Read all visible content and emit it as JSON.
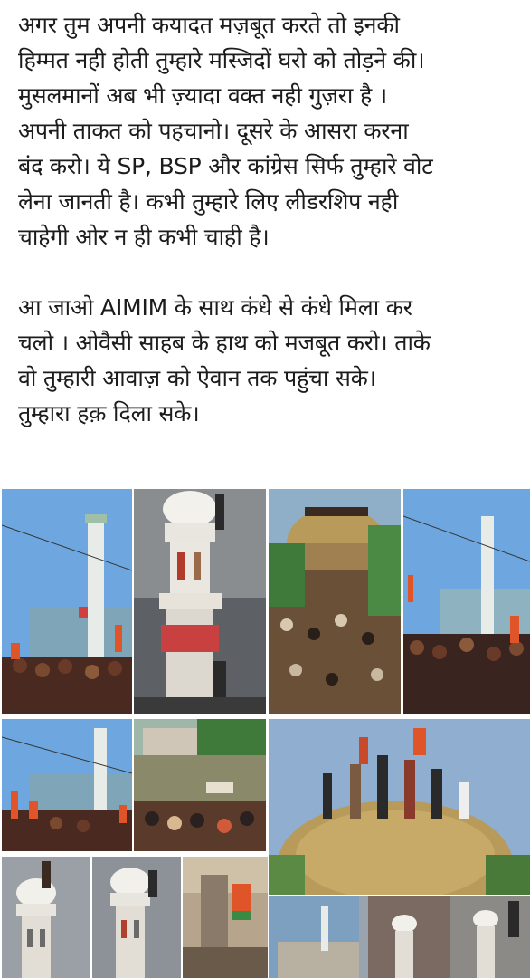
{
  "post": {
    "paragraph1_lines": [
      "अगर तुम अपनी कयादत मज़बूत करते तो इनकी",
      "हिम्मत नही होती तुम्हारे मस्जिदों घरो को तोड़ने की।",
      "मुसलमानों अब भी ज़्यादा वक्त नही गुज़रा है ।",
      "अपनी ताकत को पहचानो। दूसरे के आसरा करना",
      "बंद करो। ये SP, BSP और कांग्रेस सिर्फ तुम्हारे वोट",
      "लेना जानती है। कभी तुम्हारे लिए लीडरशिप नही",
      "चाहेगी ओर न ही कभी चाही है।"
    ],
    "paragraph2_lines": [
      "आ जाओ AIMIM के साथ कंधे से कंधे मिला कर",
      "चलो । ओवैसी साहब के हाथ को मजबूत करो। ताके",
      "वो तुम्हारी आवाज़ को ऐवान तक पहुंचा सके।",
      "तुम्हारा हक़ दिला सके।"
    ]
  },
  "collage": {
    "photo_count": 12,
    "colors": {
      "sky": "#6ea7e0",
      "dome": "#b89a5a",
      "crowd": "#5a3a2a",
      "flag": "#e0542a",
      "white_structure": "#eae7e0"
    }
  }
}
